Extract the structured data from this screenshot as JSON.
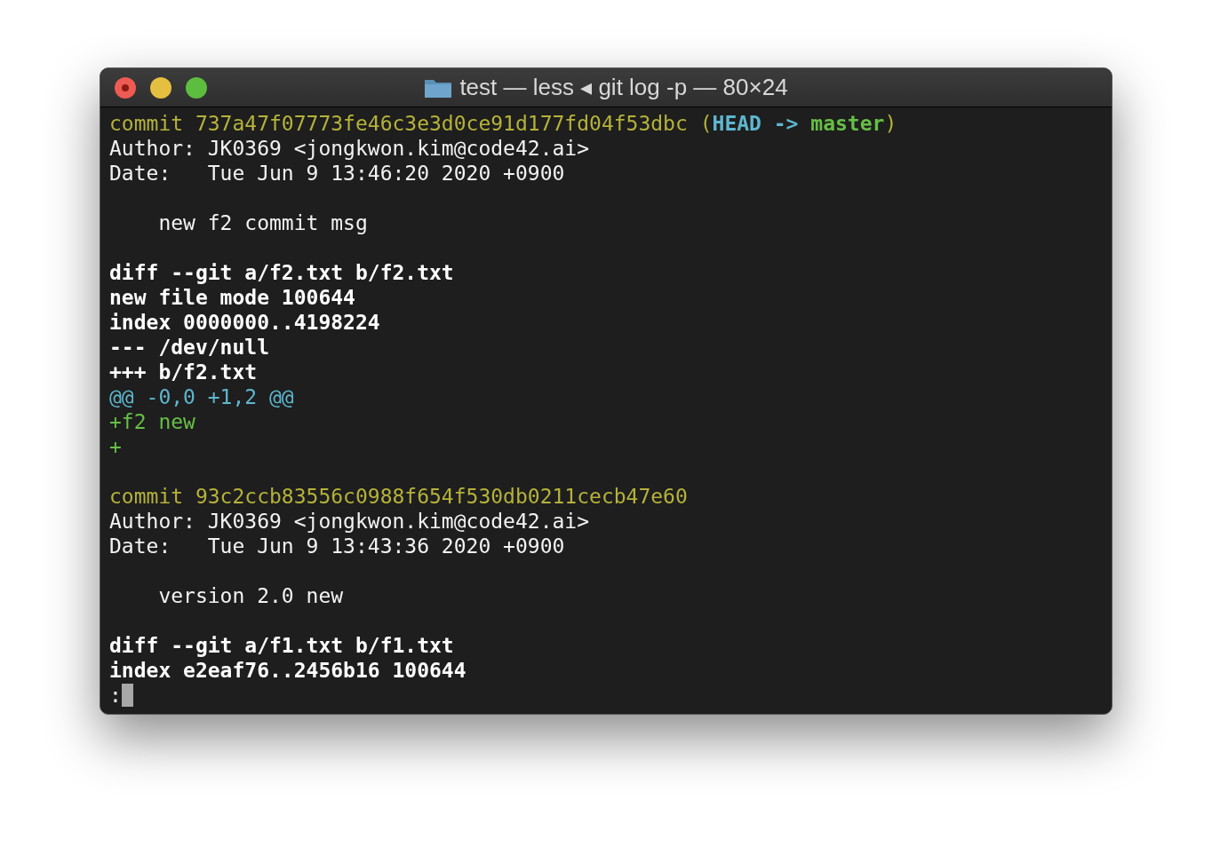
{
  "window": {
    "title": "test — less ◂ git log -p — 80×24"
  },
  "terminal": {
    "lines": [
      {
        "kind": "text",
        "segments": [
          {
            "kind": "commit",
            "text": "commit 737a47f07773fe46c3e3d0ce91d177fd04f53dbc "
          },
          {
            "kind": "paren",
            "text": "("
          },
          {
            "kind": "head",
            "text": "HEAD -> "
          },
          {
            "kind": "branch",
            "text": "master"
          },
          {
            "kind": "paren",
            "text": ")"
          }
        ]
      },
      {
        "kind": "text",
        "segments": [
          {
            "kind": "plain",
            "text": "Author: JK0369 <jongkwon.kim@code42.ai>"
          }
        ]
      },
      {
        "kind": "text",
        "segments": [
          {
            "kind": "plain",
            "text": "Date:   Tue Jun 9 13:46:20 2020 +0900"
          }
        ]
      },
      {
        "kind": "blank"
      },
      {
        "kind": "text",
        "segments": [
          {
            "kind": "plain",
            "text": "    new f2 commit msg"
          }
        ]
      },
      {
        "kind": "blank"
      },
      {
        "kind": "text",
        "segments": [
          {
            "kind": "bold",
            "text": "diff --git a/f2.txt b/f2.txt"
          }
        ]
      },
      {
        "kind": "text",
        "segments": [
          {
            "kind": "bold",
            "text": "new file mode 100644"
          }
        ]
      },
      {
        "kind": "text",
        "segments": [
          {
            "kind": "bold",
            "text": "index 0000000..4198224"
          }
        ]
      },
      {
        "kind": "text",
        "segments": [
          {
            "kind": "bold",
            "text": "--- /dev/null"
          }
        ]
      },
      {
        "kind": "text",
        "segments": [
          {
            "kind": "bold",
            "text": "+++ b/f2.txt"
          }
        ]
      },
      {
        "kind": "text",
        "segments": [
          {
            "kind": "hunk",
            "text": "@@ -0,0 +1,2 @@"
          }
        ]
      },
      {
        "kind": "text",
        "segments": [
          {
            "kind": "added",
            "text": "+f2 new"
          }
        ]
      },
      {
        "kind": "text",
        "segments": [
          {
            "kind": "added",
            "text": "+"
          }
        ]
      },
      {
        "kind": "blank"
      },
      {
        "kind": "text",
        "segments": [
          {
            "kind": "commit",
            "text": "commit 93c2ccb83556c0988f654f530db0211cecb47e60"
          }
        ]
      },
      {
        "kind": "text",
        "segments": [
          {
            "kind": "plain",
            "text": "Author: JK0369 <jongkwon.kim@code42.ai>"
          }
        ]
      },
      {
        "kind": "text",
        "segments": [
          {
            "kind": "plain",
            "text": "Date:   Tue Jun 9 13:43:36 2020 +0900"
          }
        ]
      },
      {
        "kind": "blank"
      },
      {
        "kind": "text",
        "segments": [
          {
            "kind": "plain",
            "text": "    version 2.0 new"
          }
        ]
      },
      {
        "kind": "blank"
      },
      {
        "kind": "text",
        "segments": [
          {
            "kind": "bold",
            "text": "diff --git a/f1.txt b/f1.txt"
          }
        ]
      },
      {
        "kind": "text",
        "segments": [
          {
            "kind": "bold",
            "text": "index e2eaf76..2456b16 100644"
          }
        ]
      }
    ],
    "prompt": {
      "text": ":",
      "cursor": true
    }
  }
}
